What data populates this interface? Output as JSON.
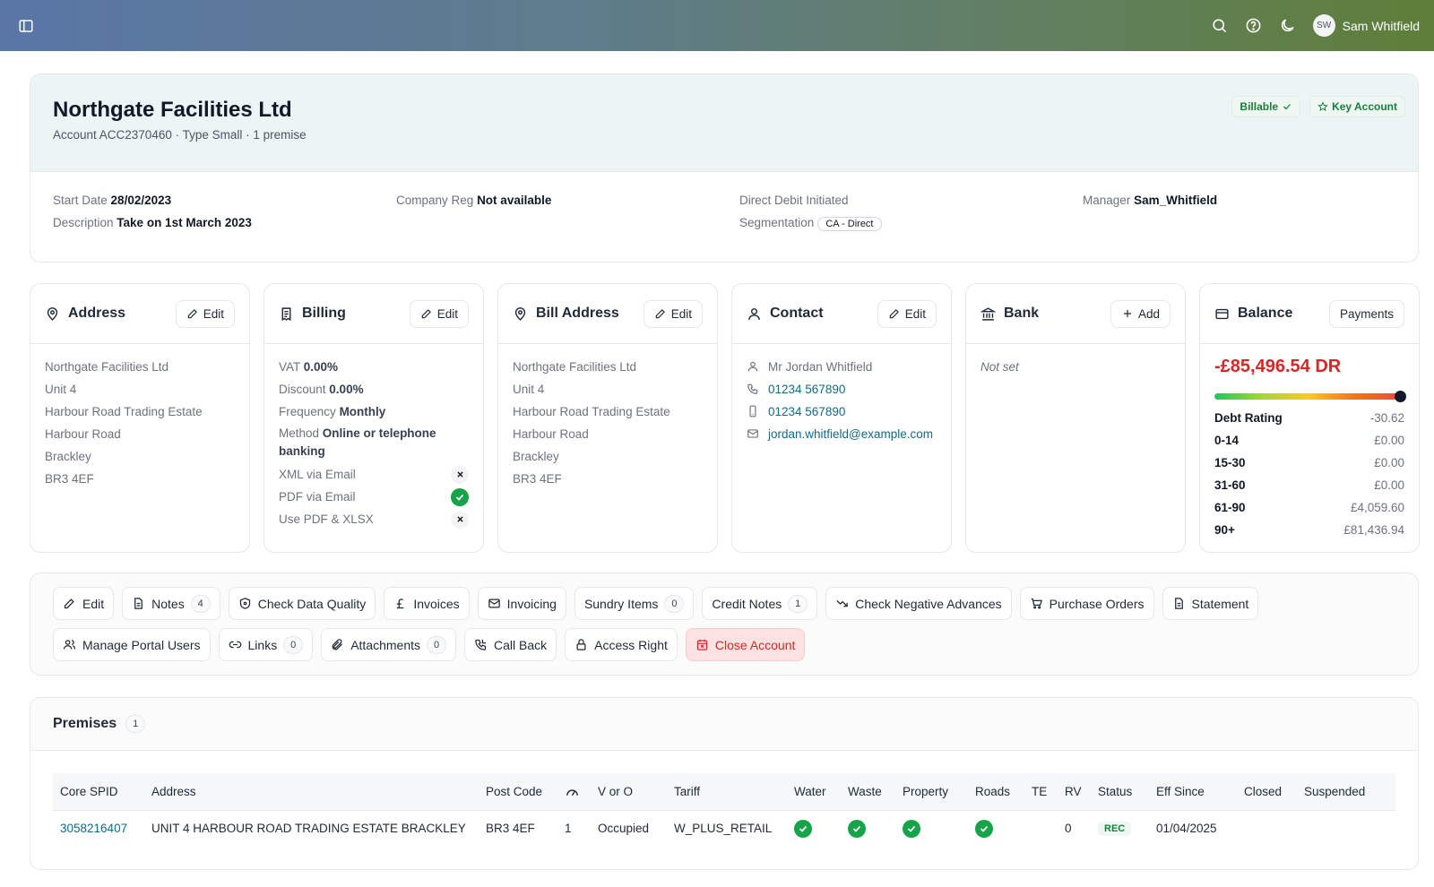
{
  "user": {
    "initials": "SW",
    "name": "Sam Whitfield"
  },
  "account": {
    "name": "Northgate Facilities Ltd",
    "subtitle": "Account ACC2370460 · Type Small · 1 premise",
    "badges": {
      "billable": "Billable",
      "key_account": "Key Account"
    },
    "fields": {
      "start_date_label": "Start Date",
      "start_date": "28/02/2023",
      "company_reg_label": "Company Reg",
      "company_reg": "Not available",
      "direct_debit": "Direct Debit Initiated",
      "manager_label": "Manager",
      "manager": "Sam_Whitfield",
      "description_label": "Description",
      "description": "Take on 1st March 2023",
      "segmentation_label": "Segmentation",
      "segmentation": "CA - Direct"
    }
  },
  "panels": {
    "address": {
      "title": "Address",
      "button": "Edit",
      "lines": [
        "Northgate Facilities Ltd",
        "Unit 4",
        "Harbour Road Trading Estate",
        "Harbour Road",
        "Brackley",
        "BR3 4EF"
      ]
    },
    "billing": {
      "title": "Billing",
      "button": "Edit",
      "vat_label": "VAT",
      "vat": "0.00%",
      "discount_label": "Discount",
      "discount": "0.00%",
      "frequency_label": "Frequency",
      "frequency": "Monthly",
      "method_label": "Method",
      "method": "Online or telephone banking",
      "xml_label": "XML via Email",
      "pdf_label": "PDF via Email",
      "pdfxlsx_label": "Use PDF & XLSX"
    },
    "bill_address": {
      "title": "Bill Address",
      "button": "Edit",
      "lines": [
        "Northgate Facilities Ltd",
        "Unit 4",
        "Harbour Road Trading Estate",
        "Harbour Road",
        "Brackley",
        "BR3 4EF"
      ]
    },
    "contact": {
      "title": "Contact",
      "button": "Edit",
      "name": "Mr Jordan Whitfield",
      "phone": "01234 567890",
      "mobile": "01234 567890",
      "email": "jordan.whitfield@example.com"
    },
    "bank": {
      "title": "Bank",
      "button": "Add",
      "value": "Not set"
    },
    "balance": {
      "title": "Balance",
      "button": "Payments",
      "amount": "-£85,496.54 DR",
      "rows": [
        {
          "label": "Debt Rating",
          "value": "-30.62"
        },
        {
          "label": "0-14",
          "value": "£0.00"
        },
        {
          "label": "15-30",
          "value": "£0.00"
        },
        {
          "label": "31-60",
          "value": "£0.00"
        },
        {
          "label": "61-90",
          "value": "£4,059.60"
        },
        {
          "label": "90+",
          "value": "£81,436.94"
        }
      ]
    }
  },
  "actions": {
    "edit": "Edit",
    "notes": "Notes",
    "notes_count": "4",
    "check_data_quality": "Check Data Quality",
    "invoices": "Invoices",
    "invoicing": "Invoicing",
    "sundry_items": "Sundry Items",
    "sundry_count": "0",
    "credit_notes": "Credit Notes",
    "credit_count": "1",
    "check_negative_advances": "Check Negative Advances",
    "purchase_orders": "Purchase Orders",
    "statement": "Statement",
    "manage_portal_users": "Manage Portal Users",
    "links": "Links",
    "links_count": "0",
    "attachments": "Attachments",
    "attachments_count": "0",
    "call_back": "Call Back",
    "access_right": "Access Right",
    "close_account": "Close Account"
  },
  "premises": {
    "title": "Premises",
    "count": "1",
    "headers": {
      "core_spid": "Core SPID",
      "address": "Address",
      "post_code": "Post Code",
      "v_or_o": "V or O",
      "tariff": "Tariff",
      "water": "Water",
      "waste": "Waste",
      "property": "Property",
      "roads": "Roads",
      "te": "TE",
      "rv": "RV",
      "status": "Status",
      "eff_since": "Eff Since",
      "closed": "Closed",
      "suspended": "Suspended"
    },
    "row": {
      "core_spid": "3058216407",
      "address": "UNIT 4 HARBOUR ROAD TRADING ESTATE BRACKLEY",
      "post_code": "BR3 4EF",
      "meters": "1",
      "v_or_o": "Occupied",
      "tariff": "W_PLUS_RETAIL",
      "rv": "0",
      "status": "REC",
      "eff_since": "01/04/2025"
    }
  }
}
